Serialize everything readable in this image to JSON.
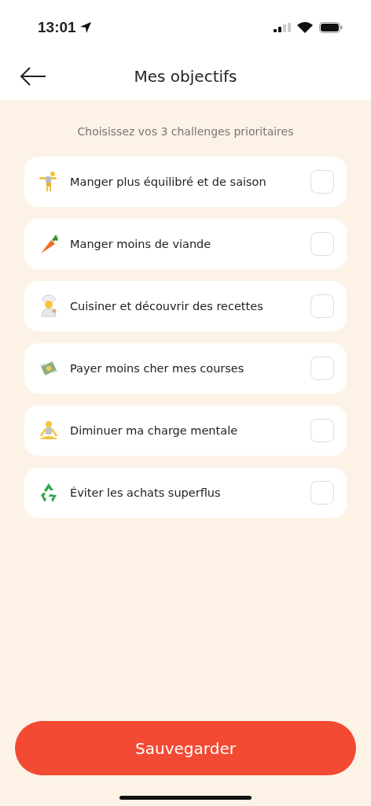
{
  "status_bar": {
    "time": "13:01"
  },
  "header": {
    "title": "Mes objectifs"
  },
  "subtitle": "Choisissez vos 3 challenges prioritaires",
  "goals": [
    {
      "label": "Manger plus équilibré et de saison",
      "checked": false
    },
    {
      "label": "Manger moins de viande",
      "checked": false
    },
    {
      "label": "Cuisiner et découvrir des recettes",
      "checked": false
    },
    {
      "label": "Payer moins cher mes courses",
      "checked": false
    },
    {
      "label": "Diminuer ma charge mentale",
      "checked": false
    },
    {
      "label": "Éviter les achats superflus",
      "checked": false
    }
  ],
  "save_button": "Sauvegarder"
}
